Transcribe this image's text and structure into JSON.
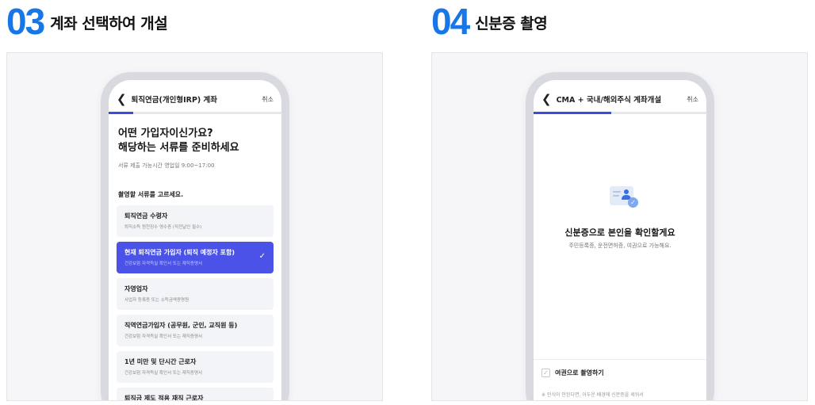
{
  "step3": {
    "number": "03",
    "title": "계좌 선택하여 개설",
    "screen": {
      "title": "퇴직연금(개인형IRP) 계좌",
      "cancel": "취소",
      "progress": 0.14,
      "question_line1": "어떤 가입자이신가요?",
      "question_line2": "해당하는 서류를 준비하세요",
      "hours": "서류 제출 가능시간 영업일 9:00~17:00",
      "pick_label": "촬영할 서류를 고르세요.",
      "options": [
        {
          "title": "퇴직연금 수령자",
          "desc": "퇴직소득 원천징수 영수증 (직전날인 필수)",
          "selected": false
        },
        {
          "title": "현재 퇴직연금 가입자 (퇴직 예정자 포함)",
          "desc": "건강보험 자격득실 확인서 또는 재직증명서",
          "selected": true
        },
        {
          "title": "자영업자",
          "desc": "사업자 등록증 또는 소득금액증명원",
          "selected": false
        },
        {
          "title": "직역연금가입자 (공무원, 군인, 교직원 등)",
          "desc": "건강보험 자격득실 확인서 또는 재직증명서",
          "selected": false
        },
        {
          "title": "1년 미만 및 단시간 근로자",
          "desc": "건강보험 자격득실 확인서 또는 재직증명서",
          "selected": false
        },
        {
          "title": "퇴직금 제도 적용 재직 근로자",
          "desc": "",
          "selected": false
        }
      ]
    }
  },
  "step4": {
    "number": "04",
    "title": "신분증 촬영",
    "screen": {
      "title": "CMA + 국내/해외주식 계좌개설",
      "cancel": "취소",
      "progress": 0.45,
      "confirm_title": "신분증으로 본인을 확인할게요",
      "confirm_sub": "주민등록증, 운전면허증, 여권으로 가능해요.",
      "passport_label": "여권으로 촬영하기",
      "note": "※ 인식이 안된다면, 어두운 배경에 신분증을 세워서"
    }
  },
  "colors": {
    "step_number": "#1877e6",
    "progress": "#3b4be0",
    "selected_option": "#4a52e8"
  },
  "icons": [
    "chevron-left-icon",
    "check-icon",
    "id-card-icon",
    "checkbox-icon"
  ]
}
